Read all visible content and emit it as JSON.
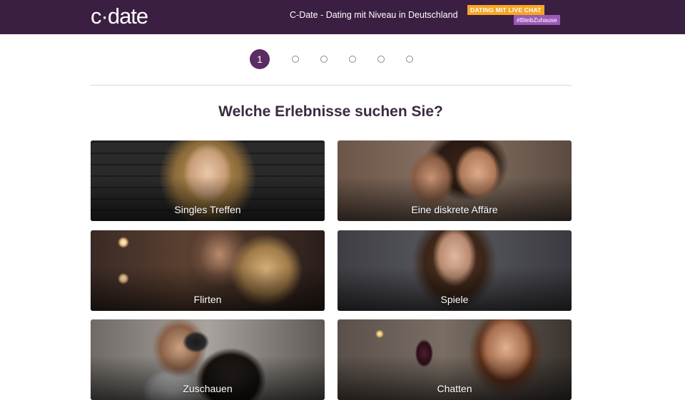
{
  "header": {
    "logo": "c·date",
    "tagline": "C-Date - Dating mit Niveau in Deutschland",
    "badge_primary": "DATING MIT LIVE CHAT",
    "badge_secondary": "#BleibZuhause",
    "bg_color": "#3b1f42"
  },
  "progress": {
    "current_step": "1",
    "total_steps": 6
  },
  "question": "Welche Erlebnisse suchen Sie?",
  "options": [
    {
      "label": "Singles Treffen"
    },
    {
      "label": "Eine diskrete Affäre"
    },
    {
      "label": "Flirten"
    },
    {
      "label": "Spiele"
    },
    {
      "label": "Zuschauen"
    },
    {
      "label": "Chatten"
    }
  ],
  "colors": {
    "accent": "#5a2d63",
    "badge_primary": "#f5a623",
    "badge_secondary": "#9b59b6"
  }
}
